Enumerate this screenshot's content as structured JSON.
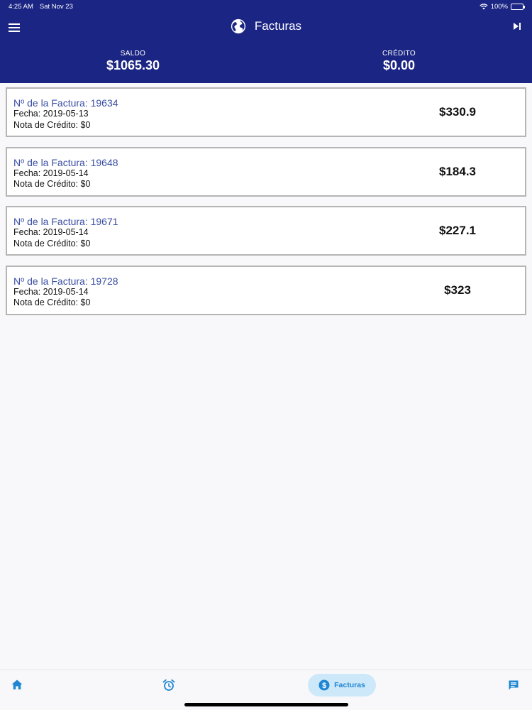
{
  "status_bar": {
    "time": "4:25 AM",
    "date": "Sat Nov 23",
    "battery": "100%"
  },
  "header": {
    "title": "Facturas",
    "globe_icon": "globe-icon",
    "menu_icon": "hamburger-menu-icon",
    "skip_icon": "skip-next-icon",
    "background_color": "#1b2583"
  },
  "balances": {
    "saldo_label": "SALDO",
    "saldo_value": "$1065.30",
    "credito_label": "CRÉDITO",
    "credito_value": "$0.00"
  },
  "invoices": [
    {
      "number": "Nº de la Factura: 19634",
      "date": "Fecha: 2019-05-13",
      "credit_note": "Nota de Crédito: $0",
      "amount": "$330.9"
    },
    {
      "number": "Nº de la Factura: 19648",
      "date": "Fecha: 2019-05-14",
      "credit_note": "Nota de Crédito: $0",
      "amount": "$184.3"
    },
    {
      "number": "Nº de la Factura: 19671",
      "date": "Fecha: 2019-05-14",
      "credit_note": "Nota de Crédito: $0",
      "amount": "$227.1"
    },
    {
      "number": "Nº de la Factura: 19728",
      "date": "Fecha: 2019-05-14",
      "credit_note": "Nota de Crédito: $0",
      "amount": "$323"
    }
  ],
  "tab_bar": {
    "active_label": "Facturas",
    "tabs": [
      {
        "icon": "home-icon"
      },
      {
        "icon": "alarm-icon"
      },
      {
        "icon": "dollar-icon",
        "label": "Facturas",
        "active": true
      },
      {
        "icon": "chat-icon"
      }
    ],
    "accent_color": "#1f86d3"
  }
}
